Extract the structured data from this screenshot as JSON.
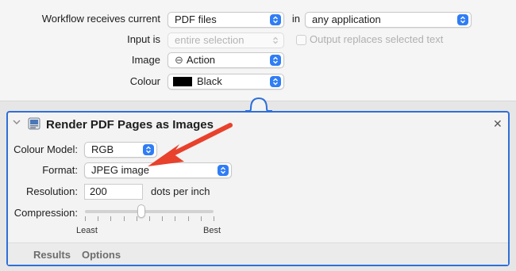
{
  "workflow": {
    "receives_label": "Workflow receives current",
    "receives_value": "PDF files",
    "in_label": "in",
    "application_value": "any application",
    "input_label": "Input is",
    "input_value": "entire selection",
    "output_replaces_label": "Output replaces selected text",
    "image_label": "Image",
    "image_value": "Action",
    "colour_label": "Colour",
    "colour_value": "Black",
    "colour_swatch": "#000000"
  },
  "action": {
    "title": "Render PDF Pages as Images",
    "colour_model_label": "Colour Model:",
    "colour_model_value": "RGB",
    "format_label": "Format:",
    "format_value": "JPEG image",
    "resolution_label": "Resolution:",
    "resolution_value": "200",
    "resolution_unit": "dots per inch",
    "compression_label": "Compression:",
    "compression_min": "Least",
    "compression_max": "Best",
    "compression_level": 0.44,
    "tabs": [
      "Results",
      "Options"
    ]
  },
  "colors": {
    "accent": "#2e6fd8",
    "arrow": "#e8412c"
  }
}
